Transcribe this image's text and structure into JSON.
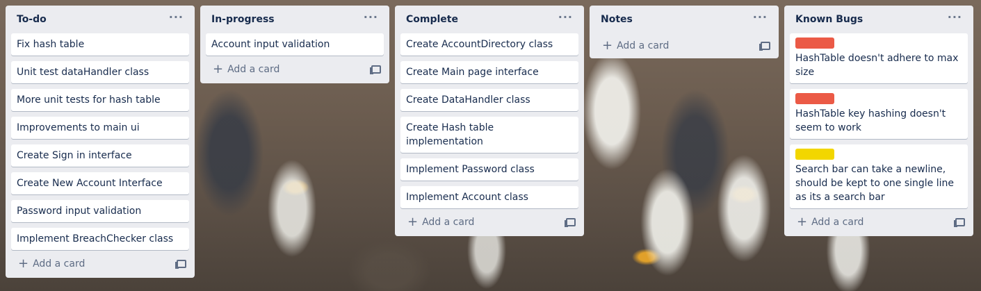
{
  "lists": [
    {
      "title": "To-do",
      "menu": "···",
      "cards": [
        {
          "text": "Fix hash table"
        },
        {
          "text": "Unit test dataHandler class"
        },
        {
          "text": "More unit tests for hash table"
        },
        {
          "text": "Improvements to main ui"
        },
        {
          "text": "Create Sign in interface"
        },
        {
          "text": "Create New Account Interface"
        },
        {
          "text": "Password input validation"
        },
        {
          "text": "Implement BreachChecker class"
        }
      ],
      "add_label": "Add a card"
    },
    {
      "title": "In-progress",
      "menu": "···",
      "cards": [
        {
          "text": "Account input validation"
        }
      ],
      "add_label": "Add a card"
    },
    {
      "title": "Complete",
      "menu": "···",
      "cards": [
        {
          "text": "Create AccountDirectory class"
        },
        {
          "text": "Create Main page interface"
        },
        {
          "text": "Create DataHandler class"
        },
        {
          "text": "Create Hash table implementation"
        },
        {
          "text": "Implement Password class"
        },
        {
          "text": "Implement Account class"
        }
      ],
      "add_label": "Add a card"
    },
    {
      "title": "Notes",
      "menu": "···",
      "cards": [],
      "add_label": "Add a card"
    },
    {
      "title": "Known Bugs",
      "menu": "···",
      "cards": [
        {
          "text": "HashTable doesn't adhere to max size",
          "label_color": "#eb5a46"
        },
        {
          "text": "HashTable key hashing doesn't seem to work",
          "label_color": "#eb5a46"
        },
        {
          "text": "Search bar can take a newline, should be kept to one single line as its a search bar",
          "label_color": "#f2d600"
        }
      ],
      "add_label": "Add a card"
    }
  ],
  "icons": {
    "add": "plus-icon",
    "template": "card-template-icon",
    "menu": "ellipsis-icon"
  },
  "colors": {
    "list_bg": "#ebecf0",
    "card_bg": "#ffffff",
    "text": "#172b4d",
    "muted": "#5e6c84",
    "label_red": "#eb5a46",
    "label_yellow": "#f2d600"
  }
}
